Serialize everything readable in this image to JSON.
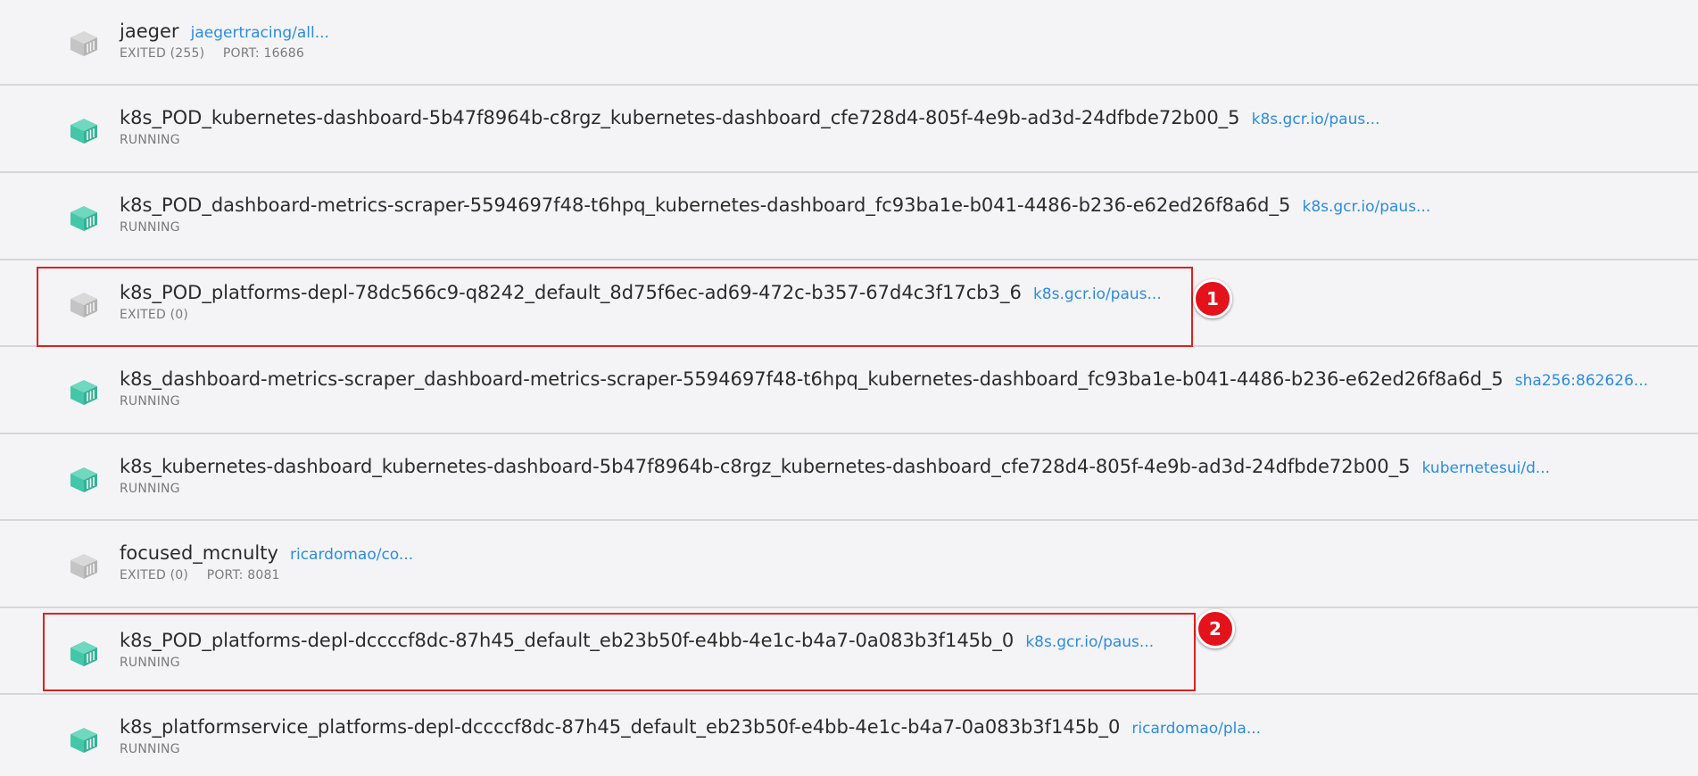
{
  "colors": {
    "running_icon": "#43c7a8",
    "exited_icon": "#c4c4c4",
    "image_link": "#2b8ce0",
    "highlight": "#e02020",
    "badge": "#e3121b"
  },
  "containers": [
    {
      "name": "jaeger",
      "image": "jaegertracing/all...",
      "status": "EXITED (255)",
      "port": "PORT: 16686",
      "icon": "container-exited-icon"
    },
    {
      "name": "k8s_POD_kubernetes-dashboard-5b47f8964b-c8rgz_kubernetes-dashboard_cfe728d4-805f-4e9b-ad3d-24dfbde72b00_5",
      "image": "k8s.gcr.io/paus...",
      "status": "RUNNING",
      "port": "",
      "icon": "container-running-icon"
    },
    {
      "name": "k8s_POD_dashboard-metrics-scraper-5594697f48-t6hpq_kubernetes-dashboard_fc93ba1e-b041-4486-b236-e62ed26f8a6d_5",
      "image": "k8s.gcr.io/paus...",
      "status": "RUNNING",
      "port": "",
      "icon": "container-running-icon"
    },
    {
      "name": "k8s_POD_platforms-depl-78dc566c9-q8242_default_8d75f6ec-ad69-472c-b357-67d4c3f17cb3_6",
      "image": "k8s.gcr.io/paus...",
      "status": "EXITED (0)",
      "port": "",
      "icon": "container-exited-icon"
    },
    {
      "name": "k8s_dashboard-metrics-scraper_dashboard-metrics-scraper-5594697f48-t6hpq_kubernetes-dashboard_fc93ba1e-b041-4486-b236-e62ed26f8a6d_5",
      "image": "sha256:862626...",
      "status": "RUNNING",
      "port": "",
      "icon": "container-running-icon"
    },
    {
      "name": "k8s_kubernetes-dashboard_kubernetes-dashboard-5b47f8964b-c8rgz_kubernetes-dashboard_cfe728d4-805f-4e9b-ad3d-24dfbde72b00_5",
      "image": "kubernetesui/d...",
      "status": "RUNNING",
      "port": "",
      "icon": "container-running-icon"
    },
    {
      "name": "focused_mcnulty",
      "image": "ricardomao/co...",
      "status": "EXITED (0)",
      "port": "PORT: 8081",
      "icon": "container-exited-icon"
    },
    {
      "name": "k8s_POD_platforms-depl-dccccf8dc-87h45_default_eb23b50f-e4bb-4e1c-b4a7-0a083b3f145b_0",
      "image": "k8s.gcr.io/paus...",
      "status": "RUNNING",
      "port": "",
      "icon": "container-running-icon"
    },
    {
      "name": "k8s_platformservice_platforms-depl-dccccf8dc-87h45_default_eb23b50f-e4bb-4e1c-b4a7-0a083b3f145b_0",
      "image": "ricardomao/pla...",
      "status": "RUNNING",
      "port": "",
      "icon": "container-running-icon"
    }
  ],
  "annotations": [
    {
      "label": "1"
    },
    {
      "label": "2"
    }
  ]
}
